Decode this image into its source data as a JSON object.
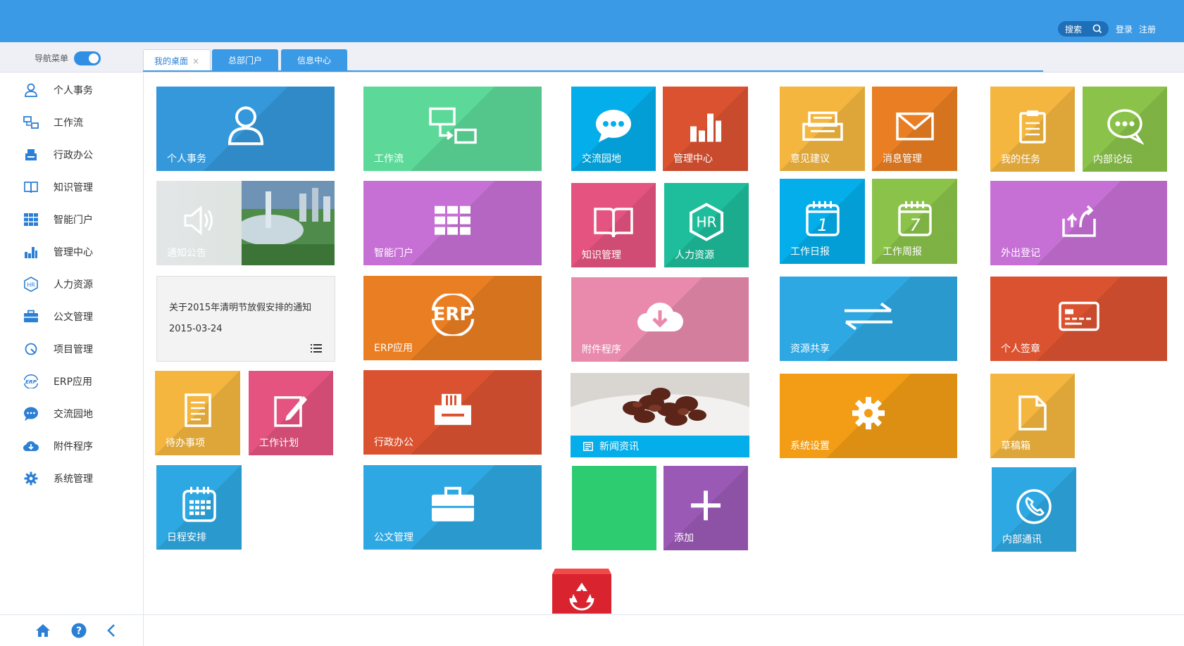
{
  "header": {
    "search_label": "搜索",
    "login": "登录",
    "register": "注册"
  },
  "nav": {
    "toggle_label": "导航菜单",
    "tabs": [
      {
        "label": "我的桌面",
        "close": "×"
      },
      {
        "label": "总部门户"
      },
      {
        "label": "信息中心"
      }
    ]
  },
  "sidebar": {
    "items": [
      {
        "label": "个人事务",
        "icon": "user-icon"
      },
      {
        "label": "工作流",
        "icon": "workflow-icon"
      },
      {
        "label": "行政办公",
        "icon": "printer-icon"
      },
      {
        "label": "知识管理",
        "icon": "book-icon"
      },
      {
        "label": "智能门户",
        "icon": "grid-icon"
      },
      {
        "label": "管理中心",
        "icon": "bar-chart-icon"
      },
      {
        "label": "人力资源",
        "icon": "hr-icon"
      },
      {
        "label": "公文管理",
        "icon": "briefcase-icon"
      },
      {
        "label": "项目管理",
        "icon": "project-icon"
      },
      {
        "label": "ERP应用",
        "icon": "erp-icon"
      },
      {
        "label": "交流园地",
        "icon": "chat-icon"
      },
      {
        "label": "附件程序",
        "icon": "cloud-download-icon"
      },
      {
        "label": "系统管理",
        "icon": "gear-icon"
      }
    ]
  },
  "tiles": {
    "personal": "个人事务",
    "workflow": "工作流",
    "exchange": "交流园地",
    "management": "管理中心",
    "suggestion": "意见建议",
    "message": "消息管理",
    "my_tasks": "我的任务",
    "forum": "内部论坛",
    "announcement": "通知公告",
    "portal": "智能门户",
    "knowledge": "知识管理",
    "hr": "人力资源",
    "daily": "工作日报",
    "daily_num": "1",
    "weekly": "工作周报",
    "weekly_num": "7",
    "outing": "外出登记",
    "erp": "ERP应用",
    "attachment": "附件程序",
    "share": "资源共享",
    "signature": "个人签章",
    "todo": "待办事项",
    "plan": "工作计划",
    "admin": "行政办公",
    "news": "新闻资讯",
    "settings": "系统设置",
    "draft": "草稿箱",
    "schedule": "日程安排",
    "documents": "公文管理",
    "add": "添加",
    "phone": "内部通讯",
    "hr_mark": "HR",
    "erp_mark": "ERP"
  },
  "notice": {
    "title": "关于2015年清明节放假安排的通知",
    "date": "2015-03-24"
  },
  "colors": {
    "header_blue": "#3b9ae6",
    "blue": "#3498db",
    "green": "#5cd999",
    "cyan": "#03aeea",
    "orange_red": "#db5230",
    "yellow": "#f4b63f",
    "orange": "#ea7e22",
    "lime": "#8bc34a",
    "purple": "#c670d5",
    "pink": "#e55480",
    "teal": "#1ebd9b",
    "light_pink": "#e98aad",
    "sky": "#2ea8e2",
    "amber": "#f29d15",
    "violet": "#9b59b6",
    "emerald": "#2ecc71",
    "recycle_red": "#d9232f"
  },
  "footer": {
    "icons": [
      "home-icon",
      "help-icon",
      "collapse-icon"
    ]
  }
}
